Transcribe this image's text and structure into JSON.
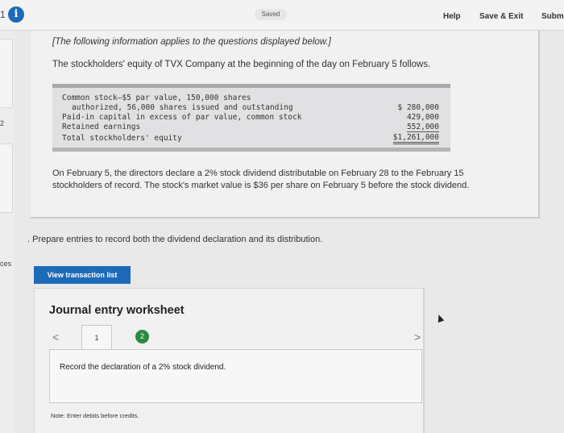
{
  "topbar": {
    "question_number": "1",
    "saved_label": "Saved",
    "help_label": "Help",
    "save_exit_label": "Save & Exit",
    "submit_label": "Submi"
  },
  "sidebar": {
    "num_2": "2",
    "bottom_label": "ces"
  },
  "content": {
    "intro": "[The following information applies to the questions displayed below.]",
    "equity_intro": "The stockholders' equity of TVX Company at the beginning of the day on February 5 follows.",
    "table": {
      "row1_label_a": "Common stock—$5 par value, 150,000 shares",
      "row1_label_b": "authorized, 56,000 shares issued and outstanding",
      "row1_value": "$ 280,000",
      "row2_label": "Paid-in capital in excess of par value, common stock",
      "row2_value": "429,000",
      "row3_label": "Retained earnings",
      "row3_value": "552,000",
      "row4_label": "Total stockholders' equity",
      "row4_value": "$1,261,000"
    },
    "paragraph": "On February 5, the directors declare a 2% stock dividend distributable on February 28 to the February 15 stockholders of record. The stock's market value is $36 per share on February 5 before the stock dividend."
  },
  "prompt": ". Prepare entries to record both the dividend declaration and its distribution.",
  "view_transaction_label": "View transaction list",
  "journal": {
    "title": "Journal entry worksheet",
    "step1": "1",
    "step2": "2",
    "instruction": "Record the declaration of a 2% stock dividend.",
    "note": "Note: Enter debits before credits."
  },
  "colors": {
    "accent": "#1d6bb8",
    "step_active": "#2b8a3e"
  }
}
